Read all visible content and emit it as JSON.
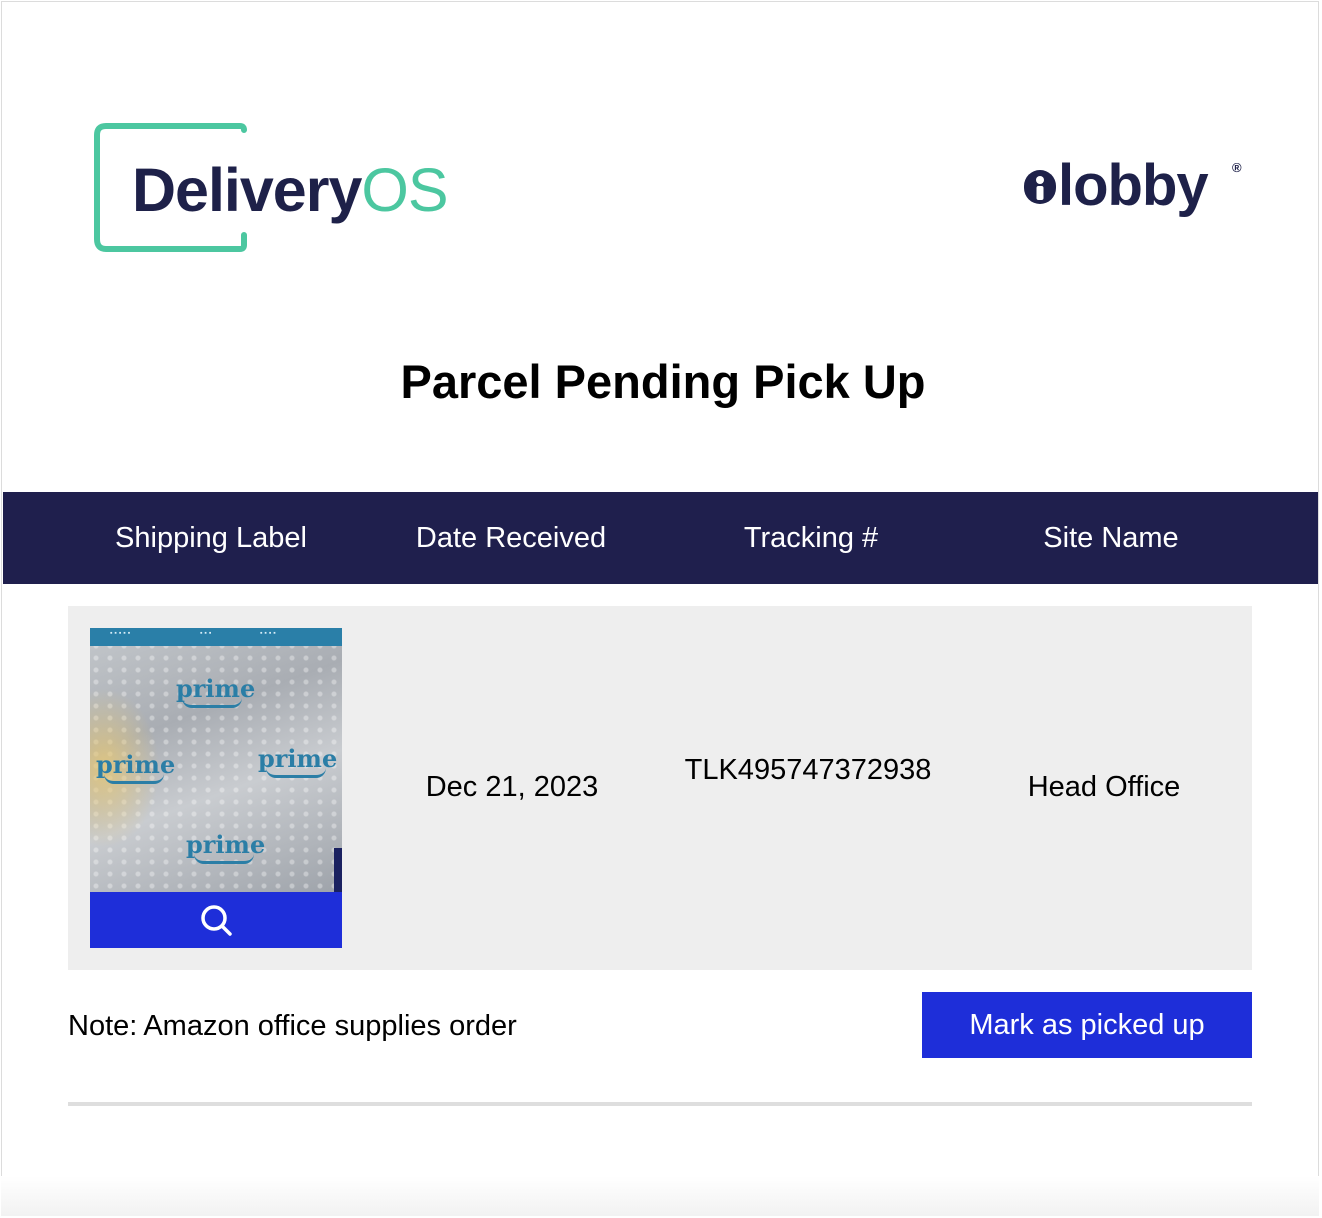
{
  "brand": {
    "left_logo": {
      "part1": "Delivery",
      "part2": "OS",
      "icon": "bracket-logo-icon",
      "colors": {
        "dark": "#1e2149",
        "accent": "#4cc7a0"
      }
    },
    "right_logo": {
      "text": "lobby",
      "registered": "®",
      "icon": "lock-i-logo-icon",
      "color": "#1e2149"
    }
  },
  "page_title": "Parcel Pending Pick Up",
  "table": {
    "header_bg": "#1f1f4d",
    "columns": [
      "Shipping Label",
      "Date Received",
      "Tracking #",
      "Site Name"
    ],
    "rows": [
      {
        "shipping_label": {
          "image": "amazon-prime-mailer-photo",
          "zoom_icon": "search-icon"
        },
        "date_received": "Dec 21, 2023",
        "tracking": "TLK495747372938",
        "site_name": "Head Office"
      }
    ]
  },
  "label_photo": {
    "prime_words": [
      "prime",
      "prime",
      "prime",
      "prime"
    ]
  },
  "note": {
    "label": "Note:",
    "text": "Amazon office supplies order"
  },
  "actions": {
    "mark_picked_up": "Mark as picked up",
    "button_color": "#1e2ed9"
  }
}
